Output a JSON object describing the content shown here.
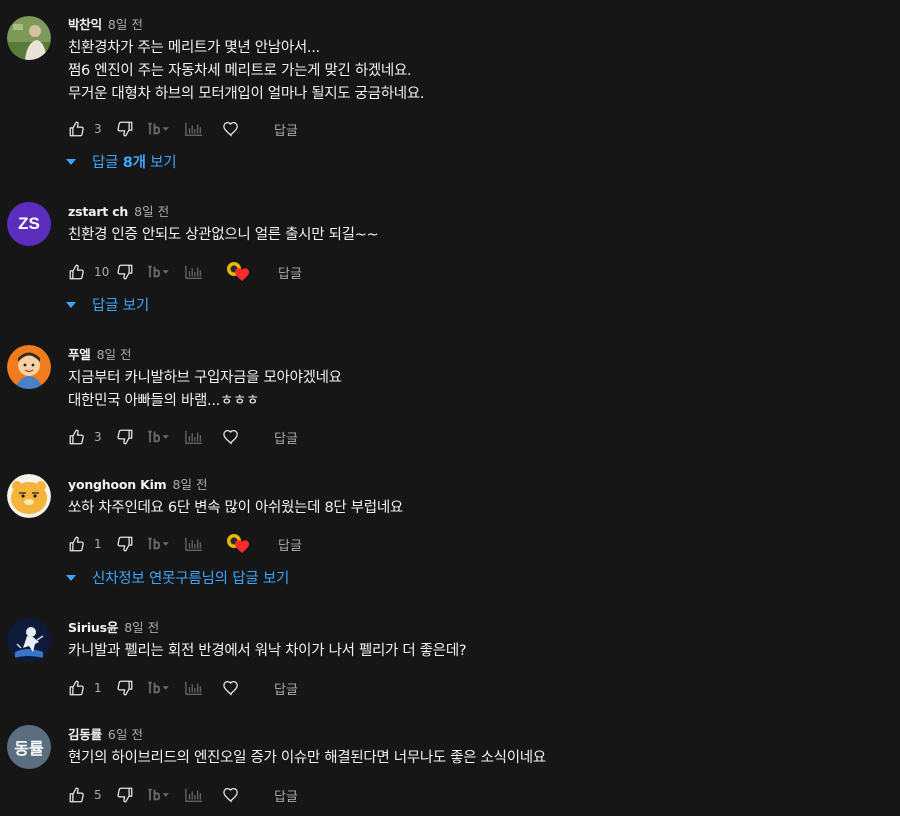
{
  "colors": {
    "background": "#161616",
    "text": "#f1f1f1",
    "meta": "#aaaaaa",
    "link": "#3ea6ff",
    "heart": "#ff2a2a"
  },
  "icons": {
    "like": "thumb-up-icon",
    "dislike": "thumb-down-icon",
    "tool": "font-size-icon",
    "bars": "bar-chart-icon",
    "heart": "heart-outline-icon",
    "creator_heart": "creator-heart-icon",
    "replies": "caret-down-icon"
  },
  "reply_label": "답글",
  "comments": [
    {
      "author": "박찬익",
      "time": "8일 전",
      "avatar_initials": "",
      "lines": [
        "친환경차가 주는 메리트가 몇년 안남아서...",
        "쩜6 엔진이 주는 자동차세 메리트로 가는게 맞긴 하겠네요.",
        "무거운 대형차 하브의 모터개입이 얼마나 될지도 궁금하네요."
      ],
      "likes": "3",
      "creator_hearted": false,
      "replies_label_prefix": "답글 ",
      "replies_label_bold": "8개",
      "replies_label_suffix": " 보기"
    },
    {
      "author": "zstart ch",
      "time": "8일 전",
      "avatar_initials": "ZS",
      "lines": [
        "친환경 인증 안되도 상관없으니 얼른 출시만 되길~~"
      ],
      "likes": "10",
      "creator_hearted": true,
      "replies_label": "답글 보기"
    },
    {
      "author": "푸엘",
      "time": "8일 전",
      "avatar_initials": "",
      "lines": [
        "지금부터 카니발하브 구입자금을 모아야겠네요",
        "대한민국 아빠들의 바램...ㅎㅎㅎ"
      ],
      "likes": "3",
      "creator_hearted": false
    },
    {
      "author": "yonghoon Kim",
      "time": "8일 전",
      "avatar_initials": "",
      "lines": [
        "쏘하 차주인데요 6단 변속 많이 아쉬웠는데 8단 부럽네요"
      ],
      "likes": "1",
      "creator_hearted": true,
      "replies_label": "신차정보 연못구름님의 답글 보기"
    },
    {
      "author": "Sirius윤",
      "time": "8일 전",
      "avatar_initials": "",
      "lines": [
        "카니발과 펠리는 회전 반경에서 워낙 차이가 나서 펠리가 더 좋은데?"
      ],
      "likes": "1",
      "creator_hearted": false
    },
    {
      "author": "김동률",
      "time": "6일 전",
      "avatar_initials": "동률",
      "lines": [
        "현기의 하이브리드의 엔진오일 증가 이슈만 해결된다면 너무나도 좋은 소식이네요"
      ],
      "likes": "5",
      "creator_hearted": false
    }
  ]
}
